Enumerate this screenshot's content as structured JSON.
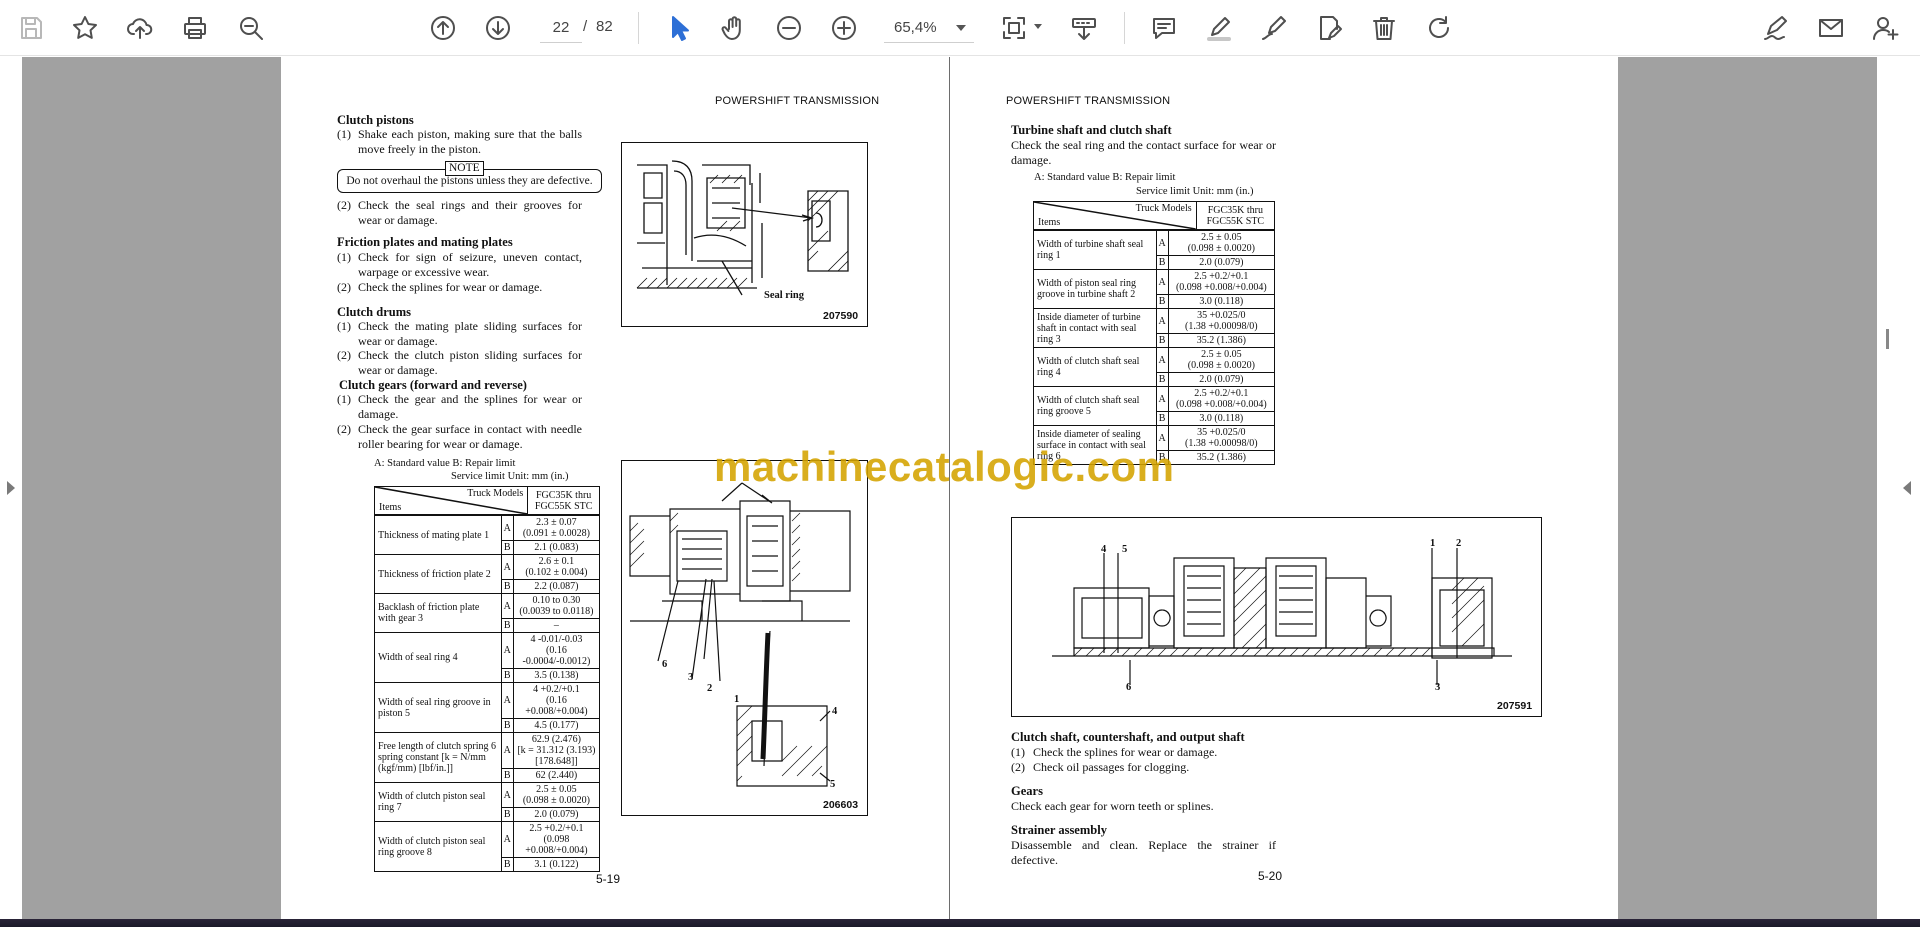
{
  "toolbar": {
    "left_icons": [
      "save-icon",
      "bookmark-star-icon",
      "upload-cloud-icon",
      "print-icon",
      "zoom-search-icon"
    ],
    "nav_icons": [
      "previous-page-icon",
      "next-page-icon"
    ],
    "current_page": "22",
    "page_separator": "/",
    "total_pages": "82",
    "zoom_value": "65,4%",
    "tool_icons": [
      "select-cursor-icon",
      "pan-hand-icon",
      "zoom-out-icon",
      "zoom-in-icon",
      "page-fit-icon",
      "scroll-mode-icon"
    ],
    "annotate_icons": [
      "comment-icon",
      "highlight-pen-icon",
      "draw-icon",
      "stamp-icon",
      "delete-icon",
      "redo-icon"
    ],
    "right_icons": [
      "sign-pen-icon",
      "email-icon",
      "add-user-icon"
    ],
    "accent_color": "#2d6fd6"
  },
  "watermark": "machinecatalogic.com",
  "left_page": {
    "header": "POWERSHIFT TRANSMISSION",
    "clutch_pistons": {
      "heading": "Clutch pistons",
      "item1_num": "(1)",
      "item1": "Shake each piston, making sure that the balls move freely in the piston.",
      "note_label": "NOTE",
      "note_text": "Do not overhaul the pistons unless they are defective.",
      "item2_num": "(2)",
      "item2": "Check the seal rings and their grooves for wear or damage."
    },
    "friction_plates": {
      "heading": "Friction plates and mating plates",
      "item1_num": "(1)",
      "item1": "Check for sign of seizure, uneven contact, warpage or excessive wear.",
      "item2_num": "(2)",
      "item2": "Check the splines for wear or damage."
    },
    "clutch_drums": {
      "heading": "Clutch drums",
      "item1_num": "(1)",
      "item1": "Check the mating plate sliding surfaces for wear or damage.",
      "item2_num": "(2)",
      "item2": "Check the clutch piston sliding surfaces for wear or damage."
    },
    "clutch_gears": {
      "heading": "Clutch gears (forward and reverse)",
      "item1_num": "(1)",
      "item1": "Check the gear and the splines for wear or damage.",
      "item2_num": "(2)",
      "item2": "Check the gear surface in contact with needle roller bearing for wear or damage."
    },
    "legend": "A: Standard value   B: Repair limit",
    "units": "Service limit   Unit: mm (in.)",
    "table": {
      "hdr_models": "Truck Models",
      "hdr_items": "Items",
      "hdr_range1": "FGC35K thru",
      "hdr_range2": "FGC55K STC",
      "rows": [
        {
          "item": "Thickness of mating plate 1",
          "a": "2.3 ± 0.07",
          "a2": "(0.091 ± 0.0028)",
          "b": "2.1 (0.083)"
        },
        {
          "item": "Thickness of friction plate 2",
          "a": "2.6 ± 0.1",
          "a2": "(0.102 ± 0.004)",
          "b": "2.2 (0.087)"
        },
        {
          "item": "Backlash of friction plate with gear 3",
          "a": "0.10 to 0.30",
          "a2": "(0.0039 to 0.0118)",
          "b": "–"
        },
        {
          "item": "Width of seal ring 4",
          "a": "4 -0.01/-0.03",
          "a2": "(0.16 -0.0004/-0.0012)",
          "b": "3.5 (0.138)"
        },
        {
          "item": "Width of seal ring groove in piston 5",
          "a": "4 +0.2/+0.1",
          "a2": "(0.16 +0.008/+0.004)",
          "b": "4.5 (0.177)"
        },
        {
          "item": "Free length of clutch spring 6 spring constant [k = N/mm (kgf/mm) [lbf/in.]]",
          "a": "62.9 (2.476)",
          "a2": "[k = 31.312 (3.193) [178.648]]",
          "b": "62 (2.440)"
        },
        {
          "item": "Width of clutch piston seal ring 7",
          "a": "2.5 ± 0.05",
          "a2": "(0.098 ± 0.0020)",
          "b": "2.0 (0.079)"
        },
        {
          "item": "Width of clutch piston seal ring groove 8",
          "a": "2.5 +0.2/+0.1",
          "a2": "(0.098 +0.008/+0.004)",
          "b": "3.1 (0.122)"
        }
      ]
    },
    "fig1": {
      "number": "207590",
      "callout": "Seal ring"
    },
    "fig2": {
      "number": "206603",
      "callouts": [
        "6",
        "3",
        "2",
        "1",
        "4",
        "5"
      ]
    },
    "page_number": "5-19"
  },
  "right_page": {
    "header": "POWERSHIFT TRANSMISSION",
    "turbine": {
      "heading": "Turbine shaft and clutch shaft",
      "text": "Check the seal ring and the contact surface for wear or damage."
    },
    "legend": "A: Standard value   B: Repair limit",
    "units": "Service limit    Unit: mm (in.)",
    "table": {
      "hdr_models": "Truck Models",
      "hdr_items": "Items",
      "hdr_range1": "FGC35K thru",
      "hdr_range2": "FGC55K STC",
      "rows": [
        {
          "item": "Width of turbine shaft seal ring 1",
          "a": "2.5 ± 0.05",
          "a2": "(0.098 ± 0.0020)",
          "b": "2.0 (0.079)"
        },
        {
          "item": "Width of piston seal ring groove in turbine shaft 2",
          "a": "2.5 +0.2/+0.1",
          "a2": "(0.098 +0.008/+0.004)",
          "b": "3.0 (0.118)"
        },
        {
          "item": "Inside diameter of turbine shaft in contact with seal ring 3",
          "a": "35 +0.025/0",
          "a2": "(1.38 +0.00098/0)",
          "b": "35.2 (1.386)"
        },
        {
          "item": "Width of clutch shaft seal ring 4",
          "a": "2.5 ± 0.05",
          "a2": "(0.098 ± 0.0020)",
          "b": "2.0 (0.079)"
        },
        {
          "item": "Width of clutch shaft seal ring groove 5",
          "a": "2.5 +0.2/+0.1",
          "a2": "(0.098 +0.008/+0.004)",
          "b": "3.0 (0.118)"
        },
        {
          "item": "Inside diameter of sealing surface in contact with seal ring 6",
          "a": "35 +0.025/0",
          "a2": "(1.38 +0.00098/0)",
          "b": "35.2 (1.386)"
        }
      ]
    },
    "fig3": {
      "number": "207591",
      "callouts": [
        "4",
        "5",
        "1",
        "2",
        "6",
        "3"
      ]
    },
    "output_shaft": {
      "heading": "Clutch shaft, countershaft, and output shaft",
      "item1_num": "(1)",
      "item1": "Check the splines for wear or damage.",
      "item2_num": "(2)",
      "item2": "Check oil passages for clogging."
    },
    "gears": {
      "heading": "Gears",
      "text": "Check each gear for worn teeth or splines."
    },
    "strainer": {
      "heading": "Strainer assembly",
      "text": "Disassemble and clean. Replace the strainer if defective."
    },
    "page_number": "5-20"
  }
}
